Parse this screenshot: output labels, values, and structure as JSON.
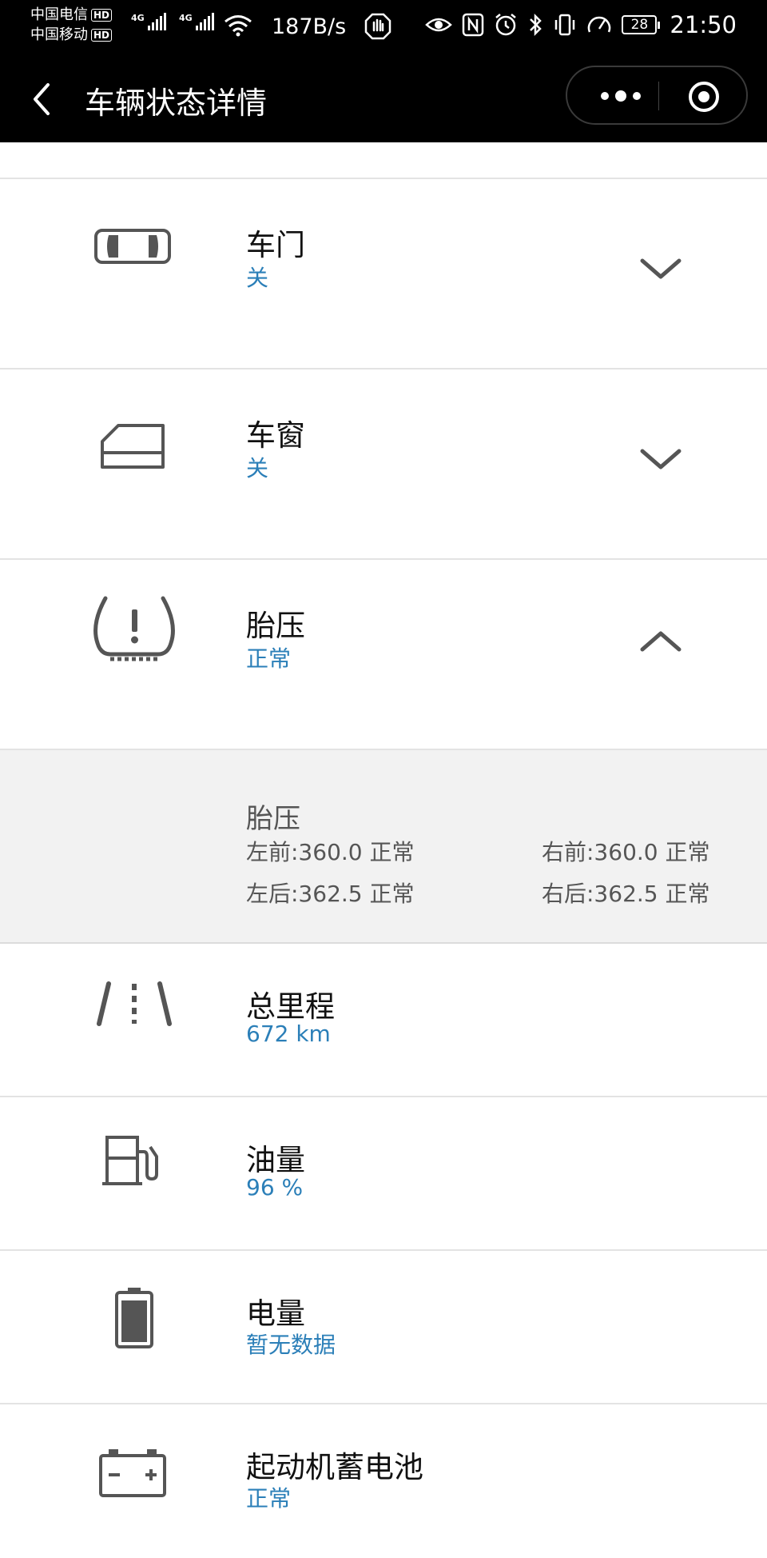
{
  "status_bar": {
    "carrier1": "中国电信",
    "carrier2": "中国移动",
    "hd": "HD",
    "net_type": "4G",
    "speed": "187B/s",
    "battery": "28",
    "time": "21:50"
  },
  "nav": {
    "title": "车辆状态详情"
  },
  "rows": {
    "door": {
      "label": "车门",
      "value": "关"
    },
    "window": {
      "label": "车窗",
      "value": "关"
    },
    "tire": {
      "label": "胎压",
      "value": "正常"
    },
    "mileage": {
      "label": "总里程",
      "value": "672 km"
    },
    "fuel": {
      "label": "油量",
      "value": "96 %"
    },
    "electric": {
      "label": "电量",
      "value": "暂无数据"
    },
    "battery": {
      "label": "起动机蓄电池",
      "value": "正常"
    }
  },
  "tire_detail": {
    "title": "胎压",
    "front_left": "左前:360.0 正常",
    "front_right": "右前:360.0 正常",
    "rear_left": "左后:362.5 正常",
    "rear_right": "右后:362.5 正常"
  },
  "colors": {
    "accent": "#2b7fb8",
    "bar_bg": "#000000",
    "detail_bg": "#f2f2f2",
    "icon": "#555555"
  }
}
